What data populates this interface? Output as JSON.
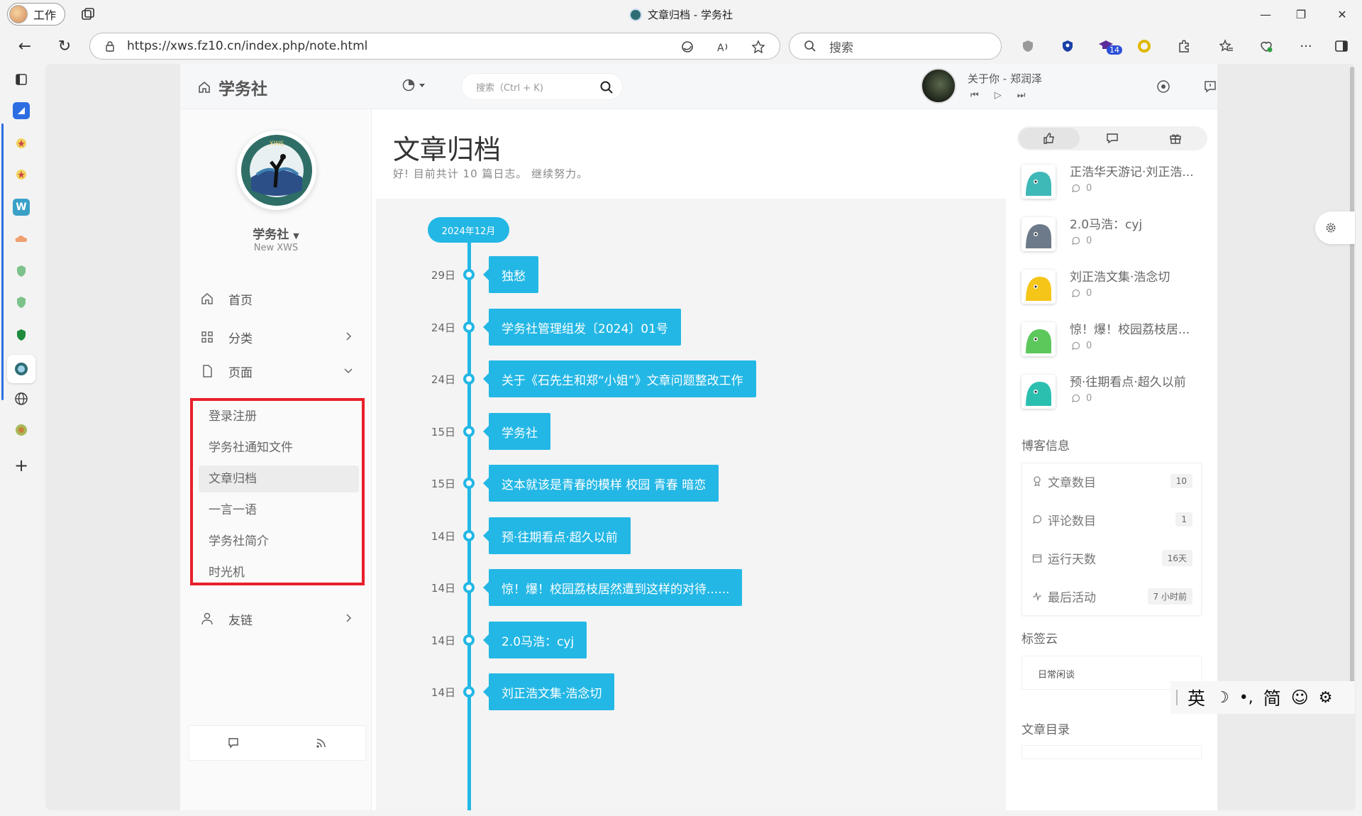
{
  "browser": {
    "profile_label": "工作",
    "window_title": "文章归档 - 学务社",
    "url": "https://xws.fz10.cn/index.php/note.html",
    "search_placeholder": "搜索",
    "ext_badge": "14"
  },
  "site": {
    "logo_text": "学务社",
    "search_placeholder": "搜索（Ctrl + K)",
    "music_title": "关于你 - 郑润泽"
  },
  "sidebar": {
    "site_name": "学务社",
    "site_sub": "New XWS",
    "menu": {
      "home": "首页",
      "category": "分类",
      "pages": "页面",
      "links": "友链"
    },
    "submenu": [
      "登录注册",
      "学务社通知文件",
      "文章归档",
      "一言一语",
      "学务社简介",
      "时光机"
    ],
    "avatar_text": "XWS"
  },
  "main": {
    "title": "文章归档",
    "subtitle": "好! 目前共计 10 篇日志。 继续努力。",
    "month": "2024年12月",
    "entries": [
      {
        "date": "29日",
        "title": "独愁"
      },
      {
        "date": "24日",
        "title": "学务社管理组发〔2024〕01号"
      },
      {
        "date": "24日",
        "title": "关于《石先生和郑“小姐”》文章问题整改工作"
      },
      {
        "date": "15日",
        "title": "学务社"
      },
      {
        "date": "15日",
        "title": "这本就该是青春的模样 校园 青春 暗恋"
      },
      {
        "date": "14日",
        "title": "预·往期看点·超久以前"
      },
      {
        "date": "14日",
        "title": "惊！爆！校园荔枝居然遭到这样的对待......"
      },
      {
        "date": "14日",
        "title": "2.0马浩：cyj"
      },
      {
        "date": "14日",
        "title": "刘正浩文集·浩念切"
      }
    ]
  },
  "right": {
    "posts": [
      {
        "title": "正浩华天游记·刘正浩...",
        "comments": "0",
        "color": "#3fb8b8"
      },
      {
        "title": "2.0马浩：cyj",
        "comments": "0",
        "color": "#6c7a89"
      },
      {
        "title": "刘正浩文集·浩念切",
        "comments": "0",
        "color": "#f5c518"
      },
      {
        "title": "惊！爆！校园荔枝居...",
        "comments": "0",
        "color": "#5cc85c"
      },
      {
        "title": "预·往期看点·超久以前",
        "comments": "0",
        "color": "#2bbfb0"
      }
    ],
    "blog_info_heading": "博客信息",
    "info": [
      {
        "label": "文章数目",
        "value": "10"
      },
      {
        "label": "评论数目",
        "value": "1"
      },
      {
        "label": "运行天数",
        "value": "16天"
      },
      {
        "label": "最后活动",
        "value": "7 小时前"
      }
    ],
    "tag_heading": "标签云",
    "tag": "日常闲谈",
    "toc_heading": "文章目录"
  },
  "ime": {
    "lang": "英",
    "script": "简"
  },
  "colors": {
    "accent": "#23b7e5",
    "highlight_border": "#e8202a"
  }
}
